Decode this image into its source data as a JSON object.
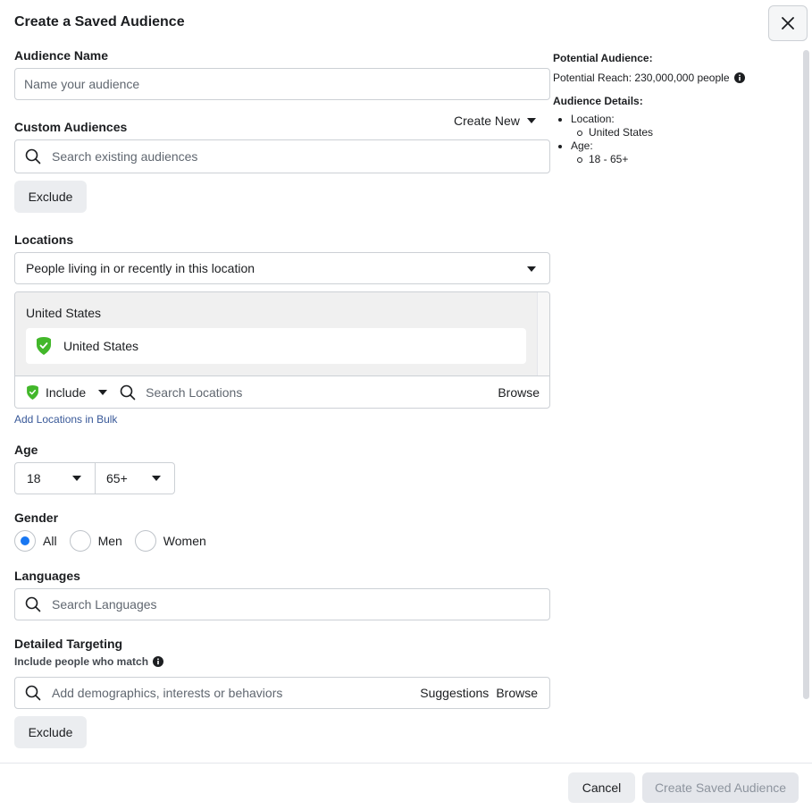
{
  "dialog": {
    "title": "Create a Saved Audience"
  },
  "audience_name": {
    "label": "Audience Name",
    "placeholder": "Name your audience"
  },
  "custom_audiences": {
    "label": "Custom Audiences",
    "create_new": "Create New",
    "search_placeholder": "Search existing audiences",
    "exclude_label": "Exclude"
  },
  "locations": {
    "label": "Locations",
    "mode": "People living in or recently in this location",
    "group_title": "United States",
    "selected": "United States",
    "include_label": "Include",
    "search_placeholder": "Search Locations",
    "browse_label": "Browse",
    "bulk_link": "Add Locations in Bulk"
  },
  "age": {
    "label": "Age",
    "min": "18",
    "max": "65+"
  },
  "gender": {
    "label": "Gender",
    "options": [
      "All",
      "Men",
      "Women"
    ],
    "selected": "All"
  },
  "languages": {
    "label": "Languages",
    "search_placeholder": "Search Languages"
  },
  "detailed_targeting": {
    "label": "Detailed Targeting",
    "sublabel": "Include people who match",
    "search_placeholder": "Add demographics, interests or behaviors",
    "suggestions_label": "Suggestions",
    "browse_label": "Browse",
    "exclude_label": "Exclude"
  },
  "summary": {
    "potential_audience_title": "Potential Audience:",
    "potential_reach": "Potential Reach: 230,000,000 people",
    "details_title": "Audience Details:",
    "location_label": "Location:",
    "location_value": "United States",
    "age_label": "Age:",
    "age_value": "18 - 65+"
  },
  "footer": {
    "cancel_label": "Cancel",
    "create_label": "Create Saved Audience"
  },
  "colors": {
    "accent": "#1877f2",
    "include_green": "#42b72a",
    "link": "#385898"
  }
}
